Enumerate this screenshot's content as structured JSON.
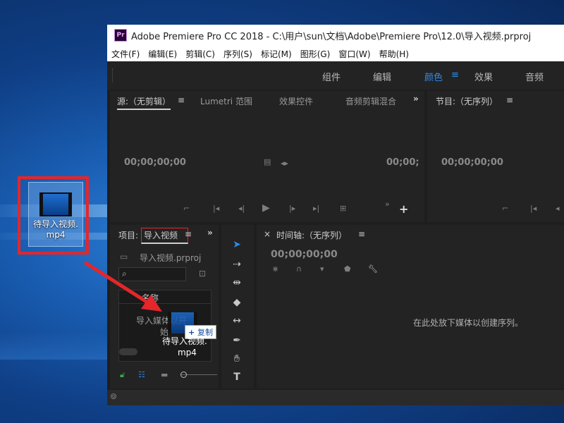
{
  "desktop": {
    "file_label_line1": "待导入视频.",
    "file_label_line2": "mp4"
  },
  "window": {
    "title": "Adobe Premiere Pro CC 2018 - C:\\用户\\sun\\文档\\Adobe\\Premiere Pro\\12.0\\导入视频.prproj",
    "logo": "Pr",
    "menu": [
      "文件(F)",
      "编辑(E)",
      "剪辑(C)",
      "序列(S)",
      "标记(M)",
      "图形(G)",
      "窗口(W)",
      "帮助(H)"
    ],
    "workspaces": [
      "组件",
      "编辑",
      "颜色",
      "效果",
      "音频"
    ],
    "active_workspace": "颜色"
  },
  "source_panel": {
    "tab_source": "源:（无剪辑）",
    "tab_lumetri": "Lumetri 范围",
    "tab_effects": "效果控件",
    "tab_audio": "音频剪辑混合",
    "timecode_left": "00;00;00;00",
    "timecode_right": "00;00;"
  },
  "program_panel": {
    "tab": "节目:（无序列）",
    "timecode": "00;00;00;00"
  },
  "project_panel": {
    "tab_project": "项目:",
    "tab_name": "导入视频",
    "file": "导入视频.prproj",
    "col_name": "名称",
    "drop_hint_line1": "导入媒体以开",
    "drop_hint_line2": "始",
    "copy_badge": "复制",
    "drag_label_line1": "待导入视频.",
    "drag_label_line2": "mp4"
  },
  "timeline_panel": {
    "tab": "时间轴:（无序列）",
    "timecode": "00;00;00;00",
    "empty_hint": "在此处放下媒体以创建序列。"
  },
  "colors": {
    "accent_blue": "#2d8ceb",
    "highlight_red": "#e5262a"
  },
  "icons": [
    "menu-icon",
    "chevrons-icon",
    "plus-icon",
    "play-icon",
    "step-back-icon",
    "step-forward-icon",
    "search-icon",
    "folder-icon",
    "selection-tool-icon",
    "track-select-icon",
    "ripple-edit-icon",
    "razor-icon",
    "slip-icon",
    "pen-icon",
    "hand-icon",
    "type-icon",
    "wrench-icon"
  ]
}
